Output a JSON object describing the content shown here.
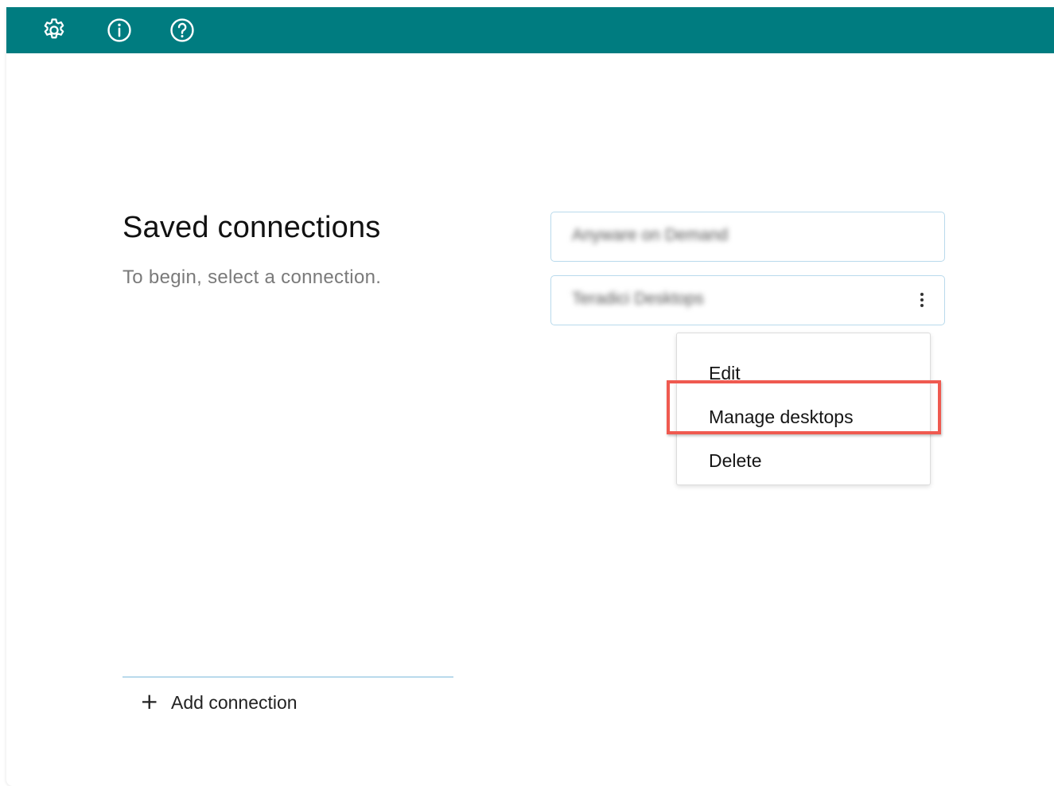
{
  "header": {
    "bg_color": "#007c80",
    "icons": [
      "gear-icon",
      "info-icon",
      "help-icon"
    ]
  },
  "main": {
    "title": "Saved connections",
    "subtitle": "To begin, select a connection."
  },
  "connections": [
    {
      "name": "Anyware on Demand"
    },
    {
      "name": "Teradici Desktops",
      "has_menu": true
    }
  ],
  "context_menu": {
    "items": [
      {
        "label": "Edit"
      },
      {
        "label": "Manage desktops",
        "highlighted": true
      },
      {
        "label": "Delete"
      }
    ],
    "highlight_color": "#ef5a50"
  },
  "footer": {
    "add_label": "Add connection",
    "add_icon": "+"
  }
}
